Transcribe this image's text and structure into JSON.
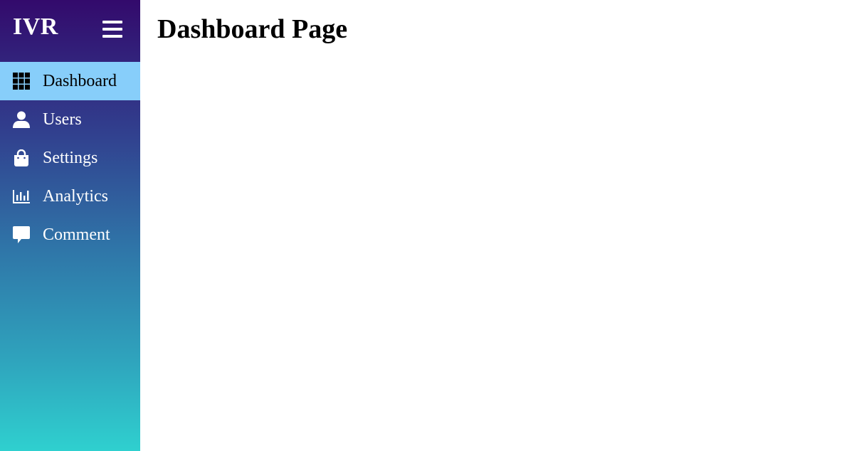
{
  "sidebar": {
    "brand": "IVR",
    "items": [
      {
        "label": "Dashboard",
        "icon": "grid-icon",
        "active": true
      },
      {
        "label": "Users",
        "icon": "user-icon",
        "active": false
      },
      {
        "label": "Settings",
        "icon": "shopping-bag-icon",
        "active": false
      },
      {
        "label": "Analytics",
        "icon": "bar-chart-icon",
        "active": false
      },
      {
        "label": "Comment",
        "icon": "comment-icon",
        "active": false
      }
    ]
  },
  "main": {
    "title": "Dashboard Page"
  },
  "colors": {
    "sidebar_gradient_top": "#330a6c",
    "sidebar_gradient_bottom": "#2fd0cf",
    "active_item_bg": "#87cefa",
    "text_light": "#ffffff",
    "text_dark": "#000000"
  }
}
